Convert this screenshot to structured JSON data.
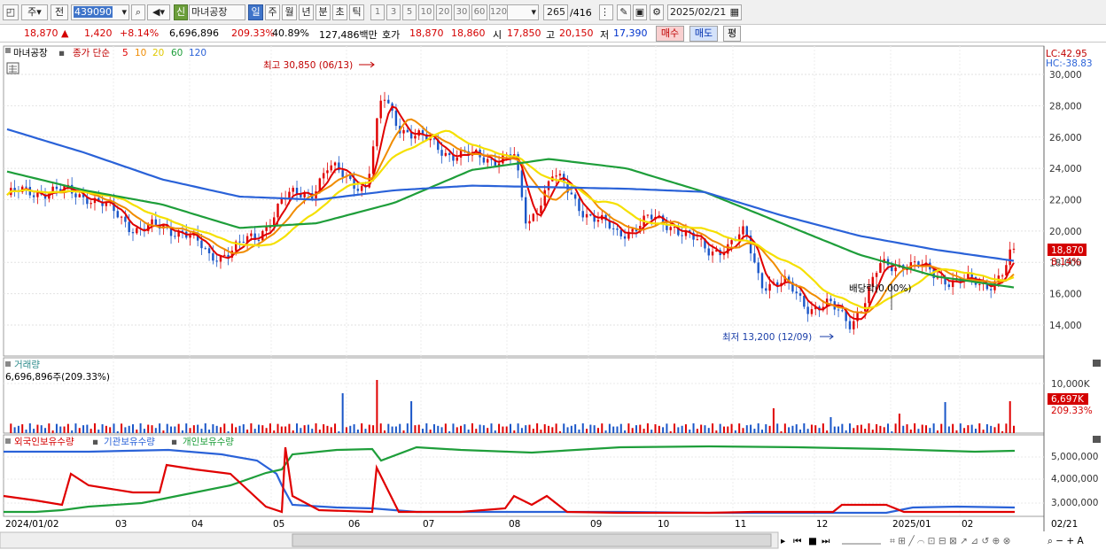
{
  "toolbar": {
    "type_label": "주",
    "prev_label": "전",
    "code": "439090",
    "stock_badge": "신",
    "stock_name": "마녀공장",
    "periods": [
      "일",
      "주",
      "월",
      "년",
      "분",
      "초",
      "틱"
    ],
    "intervals": [
      "1",
      "3",
      "5",
      "10",
      "20",
      "30",
      "60",
      "120"
    ],
    "count": "265",
    "count_total": "/416",
    "date": "2025/02/21"
  },
  "info": {
    "price": "18,870",
    "change": "1,420",
    "change_pct": "+8.14%",
    "volume": "6,696,896",
    "vol_ratio": "209.33%",
    "turnover": "40.89%",
    "amount": "127,486백만",
    "hoga_label": "호가",
    "hoga_ask": "18,870",
    "hoga_bid": "18,860",
    "open_label": "시",
    "open": "17,850",
    "high_label": "고",
    "high": "20,150",
    "low_label": "저",
    "low": "17,390",
    "buy_label": "매수",
    "sell_label": "매도",
    "eval_label": "평"
  },
  "legend": {
    "name": "마녀공장",
    "series_prefix": "종가 단순",
    "ma": [
      "5",
      "10",
      "20",
      "60",
      "120"
    ]
  },
  "price_panel": {
    "lc": "LC:42.95",
    "hc": "HC:-38.83",
    "price_tag": "18,870",
    "pct_tag": "8.14%",
    "high_annot": "최고 30,850 (06/13)",
    "low_annot": "최저 13,200 (12/09)",
    "div_annot": "배당락(0.00%)",
    "y_ticks": [
      "30,000",
      "28,000",
      "26,000",
      "24,000",
      "22,000",
      "20,000",
      "18,000",
      "16,000",
      "14,000"
    ]
  },
  "volume_panel": {
    "title": "거래량",
    "value": "6,696,896주(209.33%)",
    "y_tick": "10,000K",
    "tag": "6,697K",
    "tag_pct": "209.33%"
  },
  "holding_panel": {
    "legend": [
      "외국인보유수량",
      "기관보유수량",
      "개인보유수량"
    ],
    "y_ticks": [
      "5,000,000",
      "4,000,000",
      "3,000,000"
    ]
  },
  "x_axis": {
    "labels": [
      "2024/01/02",
      "03",
      "04",
      "05",
      "06",
      "07",
      "08",
      "09",
      "10",
      "11",
      "12",
      "2025/01",
      "02",
      "02/21"
    ]
  },
  "colors": {
    "up": "#e00000",
    "down": "#1a56c8",
    "ma5": "#e00000",
    "ma10": "#f08c00",
    "ma20": "#f5e000",
    "ma60": "#1e9e3a",
    "ma120": "#2a62d8",
    "foreign": "#e00000",
    "inst": "#2a62d8",
    "retail": "#1e9e3a"
  },
  "chart_data": {
    "type": "line",
    "title": "마녀공장",
    "x": [
      "2024-01",
      "2024-02",
      "2024-03",
      "2024-04",
      "2024-05",
      "2024-06",
      "2024-07",
      "2024-08",
      "2024-09",
      "2024-10",
      "2024-11",
      "2024-12",
      "2025-01",
      "2025-02"
    ],
    "ylim": [
      13000,
      31500
    ],
    "series": [
      {
        "name": "종가",
        "values": [
          22500,
          21500,
          20000,
          18500,
          21500,
          25000,
          25500,
          24500,
          20000,
          20500,
          18500,
          15000,
          17500,
          18870
        ]
      },
      {
        "name": "120",
        "values": [
          26500,
          25000,
          23300,
          22200,
          22000,
          22600,
          22900,
          22800,
          22700,
          22500,
          21000,
          19700,
          18800,
          18100
        ]
      },
      {
        "name": "60",
        "values": [
          23800,
          22600,
          21700,
          20200,
          20500,
          21800,
          23900,
          24600,
          24000,
          22500,
          20500,
          18500,
          17100,
          16400
        ]
      }
    ]
  }
}
